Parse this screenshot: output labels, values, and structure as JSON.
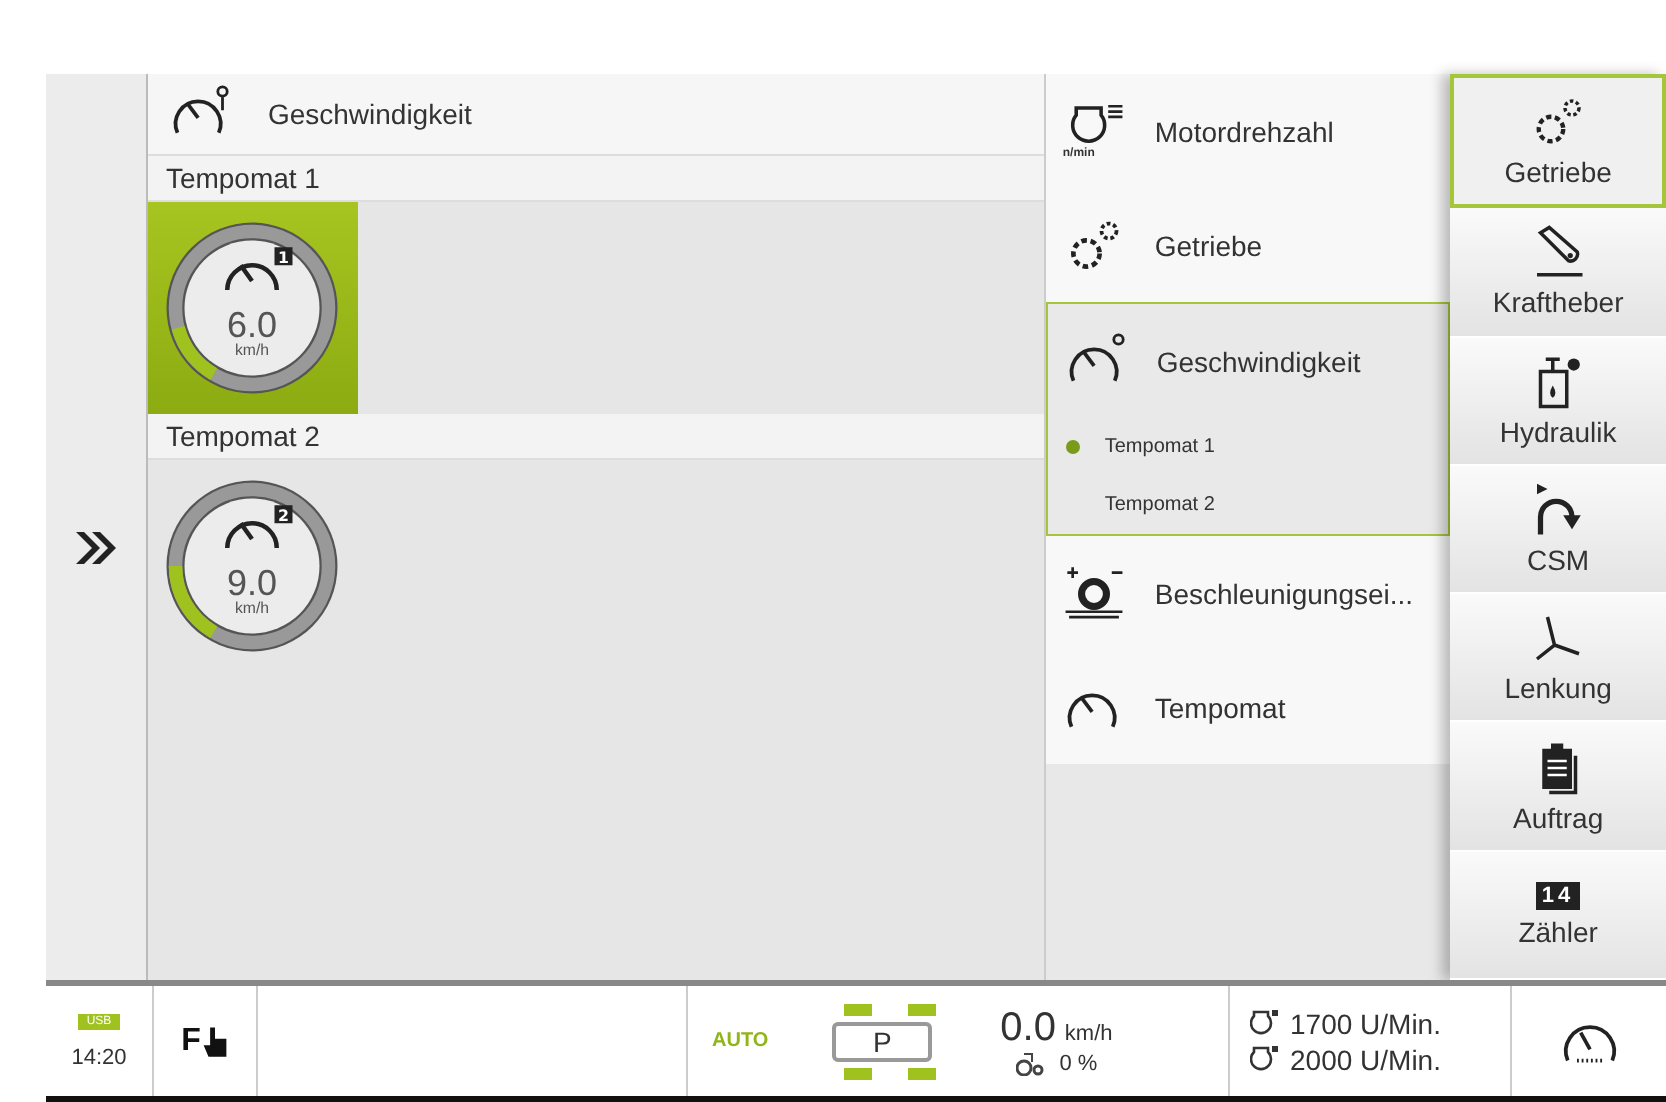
{
  "header": {
    "title": "Geschwindigkeit"
  },
  "sections": [
    {
      "label": "Tempomat 1",
      "tile": {
        "value": "6.0",
        "unit": "km/h",
        "badge": "1",
        "level": 0.15,
        "selected": true
      }
    },
    {
      "label": "Tempomat 2",
      "tile": {
        "value": "9.0",
        "unit": "km/h",
        "badge": "2",
        "level": 0.2,
        "selected": false
      }
    }
  ],
  "menu": [
    {
      "label": "Motordrehzahl",
      "icon_text": "n/min",
      "expanded": false
    },
    {
      "label": "Getriebe",
      "expanded": false
    },
    {
      "label": "Geschwindigkeit",
      "expanded": true,
      "children": [
        {
          "label": "Tempomat 1",
          "selected": true
        },
        {
          "label": "Tempomat 2",
          "selected": false
        }
      ]
    },
    {
      "label": "Beschleunigungsei...",
      "expanded": false
    },
    {
      "label": "Tempomat",
      "expanded": false
    }
  ],
  "tabs": [
    {
      "label": "Getriebe",
      "selected": true
    },
    {
      "label": "Kraftheber",
      "selected": false
    },
    {
      "label": "Hydraulik",
      "selected": false
    },
    {
      "label": "CSM",
      "selected": false
    },
    {
      "label": "Lenkung",
      "selected": false
    },
    {
      "label": "Auftrag",
      "selected": false
    },
    {
      "label": "Zähler",
      "selected": false,
      "icon_text": "14"
    }
  ],
  "status_bar": {
    "usb": "USB",
    "time": "14:20",
    "f_key": "F",
    "mode": "AUTO",
    "park": "P",
    "speed": "0.0",
    "speed_unit": "km/h",
    "slip": "0 %",
    "rpm": [
      "1700 U/Min.",
      "2000 U/Min."
    ]
  }
}
